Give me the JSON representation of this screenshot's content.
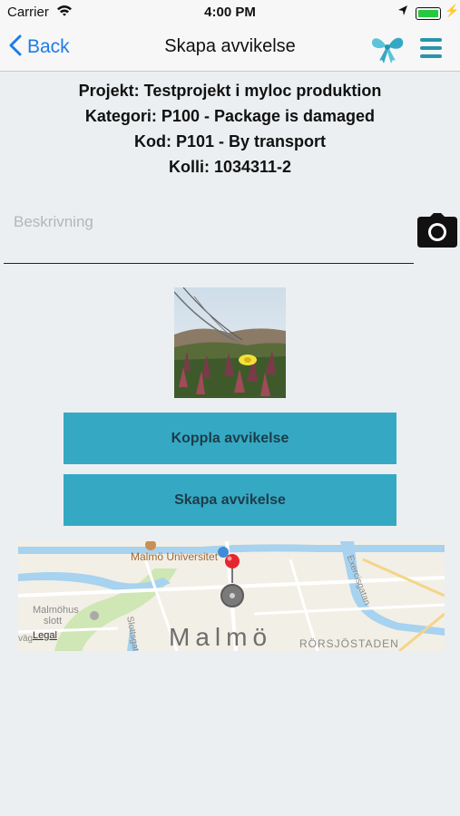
{
  "status_bar": {
    "carrier": "Carrier",
    "time": "4:00 PM"
  },
  "nav": {
    "back_label": "Back",
    "title": "Skapa avvikelse"
  },
  "info": {
    "project": "Projekt: Testprojekt i myloc produktion",
    "category": "Kategori: P100 - Package is damaged",
    "code": "Kod: P101 - By transport",
    "kolli": "Kolli: 1034311-2"
  },
  "description": {
    "placeholder": "Beskrivning",
    "value": ""
  },
  "buttons": {
    "link": "Koppla avvikelse",
    "create": "Skapa avvikelse"
  },
  "map": {
    "city": "Malmö",
    "university": "Malmö Universitet",
    "castle_line1": "Malmöhus",
    "castle_line2": "slott",
    "street1": "Slottsgatan",
    "street2": "Exercisgatan",
    "district": "RÖRSJÖSTADEN",
    "legal": "Legal",
    "fragment": "väg"
  },
  "colors": {
    "accent": "#35a9c3",
    "link": "#1e7ce6",
    "background": "#eceff1"
  }
}
